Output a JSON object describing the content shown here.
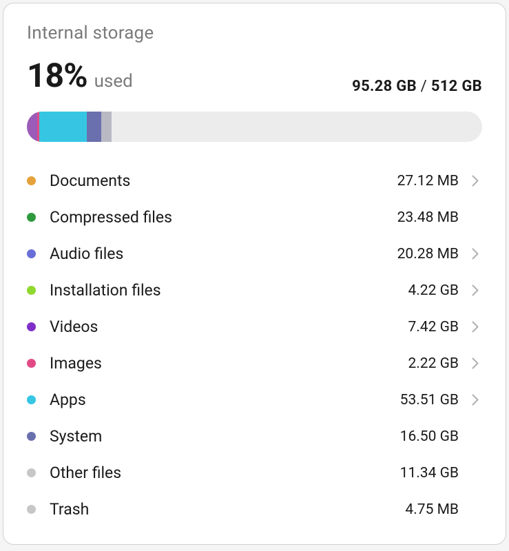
{
  "title": "Internal storage",
  "percent": "18%",
  "used_label": "used",
  "used_amount": "95.28 GB",
  "separator": " / ",
  "total_amount": "512 GB",
  "bar_segments": [
    {
      "color": "#9c5bb8",
      "width": 2.2
    },
    {
      "color": "#e24a86",
      "width": 0.5
    },
    {
      "color": "#36c6e3",
      "width": 10.5
    },
    {
      "color": "#6a6fad",
      "width": 3.2
    },
    {
      "color": "#b9b9c4",
      "width": 2.2
    }
  ],
  "categories": [
    {
      "name": "Documents",
      "size": "27.12 MB",
      "color": "#e5a23a",
      "nav": true
    },
    {
      "name": "Compressed files",
      "size": "23.48 MB",
      "color": "#2e9a3e",
      "nav": false
    },
    {
      "name": "Audio files",
      "size": "20.28 MB",
      "color": "#6a6fd8",
      "nav": true
    },
    {
      "name": "Installation files",
      "size": "4.22 GB",
      "color": "#8fd82e",
      "nav": true
    },
    {
      "name": "Videos",
      "size": "7.42 GB",
      "color": "#7e2ec9",
      "nav": true
    },
    {
      "name": "Images",
      "size": "2.22 GB",
      "color": "#e24a86",
      "nav": true
    },
    {
      "name": "Apps",
      "size": "53.51 GB",
      "color": "#36c6e3",
      "nav": true
    },
    {
      "name": "System",
      "size": "16.50 GB",
      "color": "#6a6fad",
      "nav": false
    },
    {
      "name": "Other files",
      "size": "11.34 GB",
      "color": "#c7c7c7",
      "nav": false
    },
    {
      "name": "Trash",
      "size": "4.75 MB",
      "color": "#c7c7c7",
      "nav": false
    }
  ]
}
